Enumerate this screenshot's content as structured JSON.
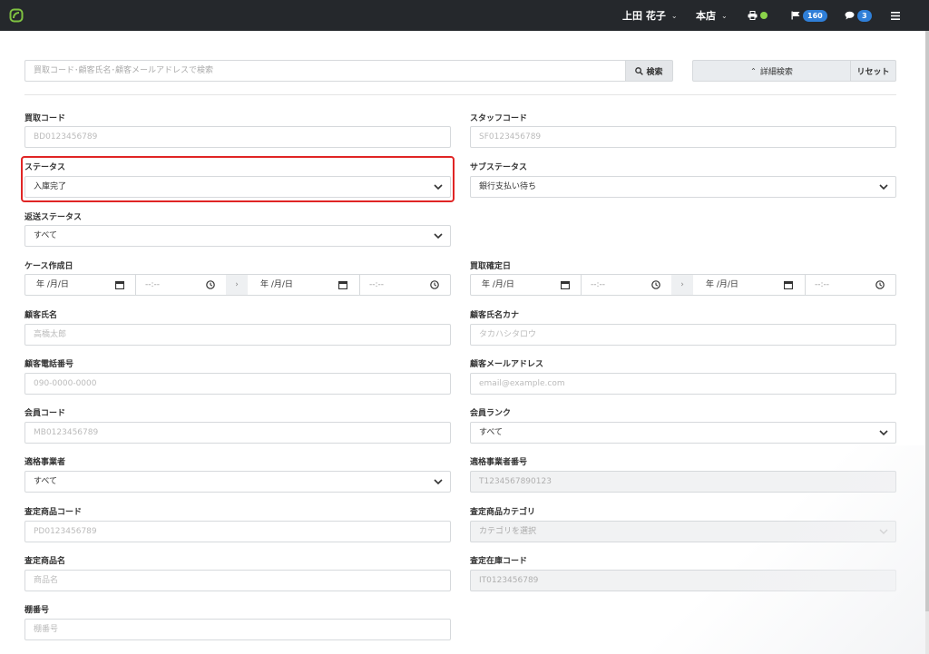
{
  "header": {
    "user_name": "上田 花子",
    "store": "本店",
    "flag_count": "160",
    "message_count": "3",
    "colors": {
      "bar": "#25282c",
      "badge": "#2f7fd8",
      "status_dot": "#8bd34a",
      "logo": "#7fc241"
    }
  },
  "search": {
    "placeholder": "買取コード･顧客氏名･顧客メールアドレスで検索",
    "search_label": "検索",
    "advanced_label": "詳細検索",
    "reset_label": "リセット"
  },
  "form": {
    "purchase_code": {
      "label": "買取コード",
      "placeholder": "BD0123456789"
    },
    "staff_code": {
      "label": "スタッフコード",
      "placeholder": "SF0123456789"
    },
    "status": {
      "label": "ステータス",
      "value": "入庫完了"
    },
    "sub_status": {
      "label": "サブステータス",
      "value": "銀行支払い待ち"
    },
    "return_status": {
      "label": "返送ステータス",
      "value": "すべて"
    },
    "case_created_date": {
      "label": "ケース作成日",
      "date_placeholder": "年 /月/日",
      "time_placeholder": "--:--"
    },
    "purchase_confirmed_date": {
      "label": "買取確定日",
      "date_placeholder": "年 /月/日",
      "time_placeholder": "--:--"
    },
    "customer_name": {
      "label": "顧客氏名",
      "placeholder": "高橋太郎"
    },
    "customer_name_kana": {
      "label": "顧客氏名カナ",
      "placeholder": "タカハシタロウ"
    },
    "customer_phone": {
      "label": "顧客電話番号",
      "placeholder": "090-0000-0000"
    },
    "customer_email": {
      "label": "顧客メールアドレス",
      "placeholder": "email@example.com"
    },
    "member_code": {
      "label": "会員コード",
      "placeholder": "MB0123456789"
    },
    "member_rank": {
      "label": "会員ランク",
      "value": "すべて"
    },
    "qualified_business": {
      "label": "適格事業者",
      "value": "すべて"
    },
    "qualified_business_number": {
      "label": "適格事業者番号",
      "placeholder": "T1234567890123"
    },
    "appraisal_product_code": {
      "label": "査定商品コード",
      "placeholder": "PD0123456789"
    },
    "appraisal_product_category": {
      "label": "査定商品カテゴリ",
      "value": "カテゴリを選択"
    },
    "appraisal_product_name": {
      "label": "査定商品名",
      "placeholder": "商品名"
    },
    "appraisal_stock_code": {
      "label": "査定在庫コード",
      "placeholder": "IT0123456789"
    },
    "shelf_number": {
      "label": "棚番号",
      "placeholder": "棚番号"
    }
  },
  "highlight_color": "#e02525"
}
